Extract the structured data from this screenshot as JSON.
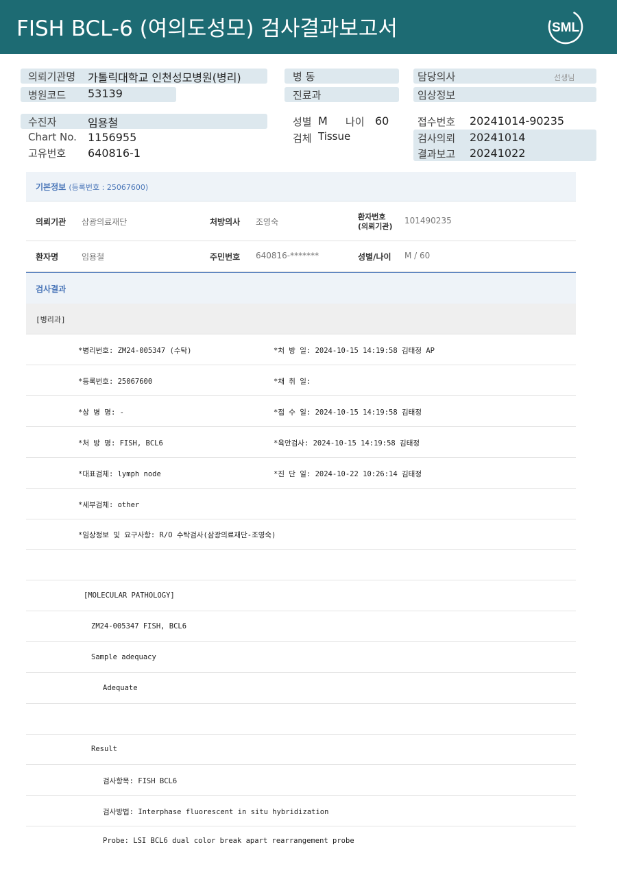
{
  "header": {
    "title": "FISH BCL-6 (여의도성모) 검사결과보고서",
    "logo_text": "SML",
    "bg_color": "#1d6b73"
  },
  "summary": {
    "requesting_org_label": "의뢰기관명",
    "requesting_org_value": "가톨릭대학교 인천성모병원(병리)",
    "hospital_code_label": "병원코드",
    "hospital_code_value": "53139",
    "ward_label": "병 동",
    "dept_label": "진료과",
    "doctor_label": "담당의사",
    "doctor_suffix": "선생님",
    "clinical_info_label": "임상정보",
    "patient_label": "수진자",
    "patient_value": "임용철",
    "chart_label": "Chart No.",
    "chart_value": "1156955",
    "unique_label": "고유번호",
    "unique_value": "640816-1",
    "sex_label": "성별",
    "sex_value": "M",
    "age_label": "나이",
    "age_value": "60",
    "specimen_label": "검체",
    "specimen_value": "Tissue",
    "receipt_label": "접수번호",
    "receipt_value": "20241014-90235",
    "request_label": "검사의뢰",
    "request_value": "20241014",
    "report_label": "결과보고",
    "report_value": "20241022"
  },
  "basic_info": {
    "title": "기본정보",
    "reg_note": "(등록번호 : 25067600)",
    "org_key": "의뢰기관",
    "org_val": "삼광의료재단",
    "presc_key": "처방의사",
    "presc_val": "조영숙",
    "pid_key_1": "환자번호",
    "pid_key_2": "(의뢰기관)",
    "pid_val": "101490235",
    "name_key": "환자명",
    "name_val": "임용철",
    "rrn_key": "주민번호",
    "rrn_val": "640816-*******",
    "sexage_key": "성별/나이",
    "sexage_val": "M / 60"
  },
  "results": {
    "title": "검사결과",
    "dept": "[병리과]",
    "rows": [
      {
        "left": "*병리번호: ZM24-005347 (수탁)",
        "right": "*처 방 일: 2024-10-15 14:19:58  김태정 AP"
      },
      {
        "left": "*등록번호: 25067600",
        "right": "*채 취 일:"
      },
      {
        "left": "*상 병 명: -",
        "right": "*접 수 일: 2024-10-15 14:19:58  김태정"
      },
      {
        "left": "*처 방 명: FISH, BCL6",
        "right": "*육안검사: 2024-10-15 14:19:58  김태정"
      },
      {
        "left": "*대표검체: lymph node",
        "right": "*진 단 일: 2024-10-22 10:26:14  김태정"
      },
      {
        "left": "*세부검체: other",
        "right": ""
      },
      {
        "left": "*임상정보 및 요구사항: R/O 수탁검사(삼광의료재단-조영숙)",
        "right": ""
      }
    ],
    "report_lines": [
      "",
      "[MOLECULAR PATHOLOGY]",
      "ZM24-005347     FISH, BCL6",
      "Sample adequacy",
      "Adequate",
      "",
      "Result",
      "검사항목: FISH BCL6",
      "검사방법: Interphase fluorescent in situ hybridization",
      "Probe: LSI BCL6 dual color break apart rearrangement probe"
    ]
  }
}
